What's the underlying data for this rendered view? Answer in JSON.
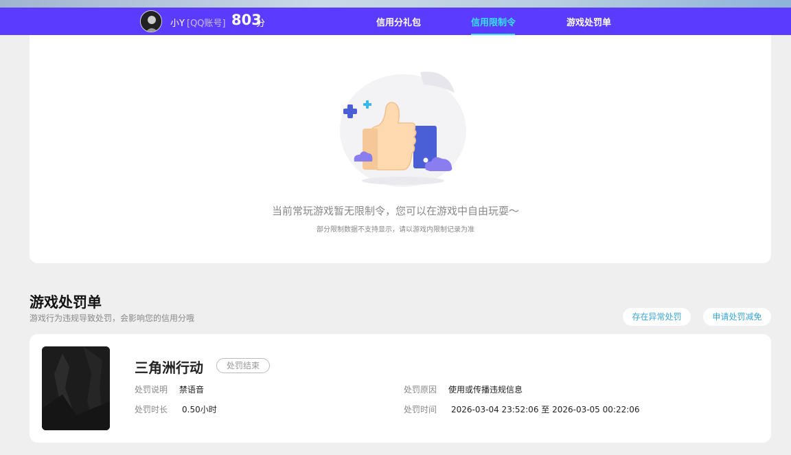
{
  "header": {
    "nickname": "小Y",
    "account_type": "[QQ账号]",
    "score": "803",
    "score_unit": "分",
    "tabs": [
      {
        "label": "信用分礼包",
        "active": false
      },
      {
        "label": "信用限制令",
        "active": true
      },
      {
        "label": "游戏处罚单",
        "active": false
      }
    ]
  },
  "restriction": {
    "message": "当前常玩游戏暂无限制令，您可以在游戏中自由玩耍～",
    "note": "部分限制数据不支持显示，请以游戏内限制记录为准"
  },
  "punishment": {
    "title": "游戏处罚单",
    "subtitle": "游戏行为违规导致处罚，会影响您的信用分哦",
    "abnormal_button": "存在异常处罚",
    "apply_button": "申请处罚减免",
    "record": {
      "game": "三角洲行动",
      "status": "处罚结束",
      "desc_label": "处罚说明",
      "desc_value": "禁语音",
      "reason_label": "处罚原因",
      "reason_value": "使用或传播违规信息",
      "duration_label": "处罚时长",
      "duration_value": "0.50小时",
      "time_label": "处罚时间",
      "time_value": "2026-03-04 23:52:06 至 2026-03-05 00:22:06"
    }
  },
  "colors": {
    "nav_bg": "#5b3cff",
    "active_tab": "#35e1ff",
    "link_blue": "#39a6d6",
    "illustration_blue": "#4a5fd6",
    "thumb_skin": "#ffd9b0"
  }
}
